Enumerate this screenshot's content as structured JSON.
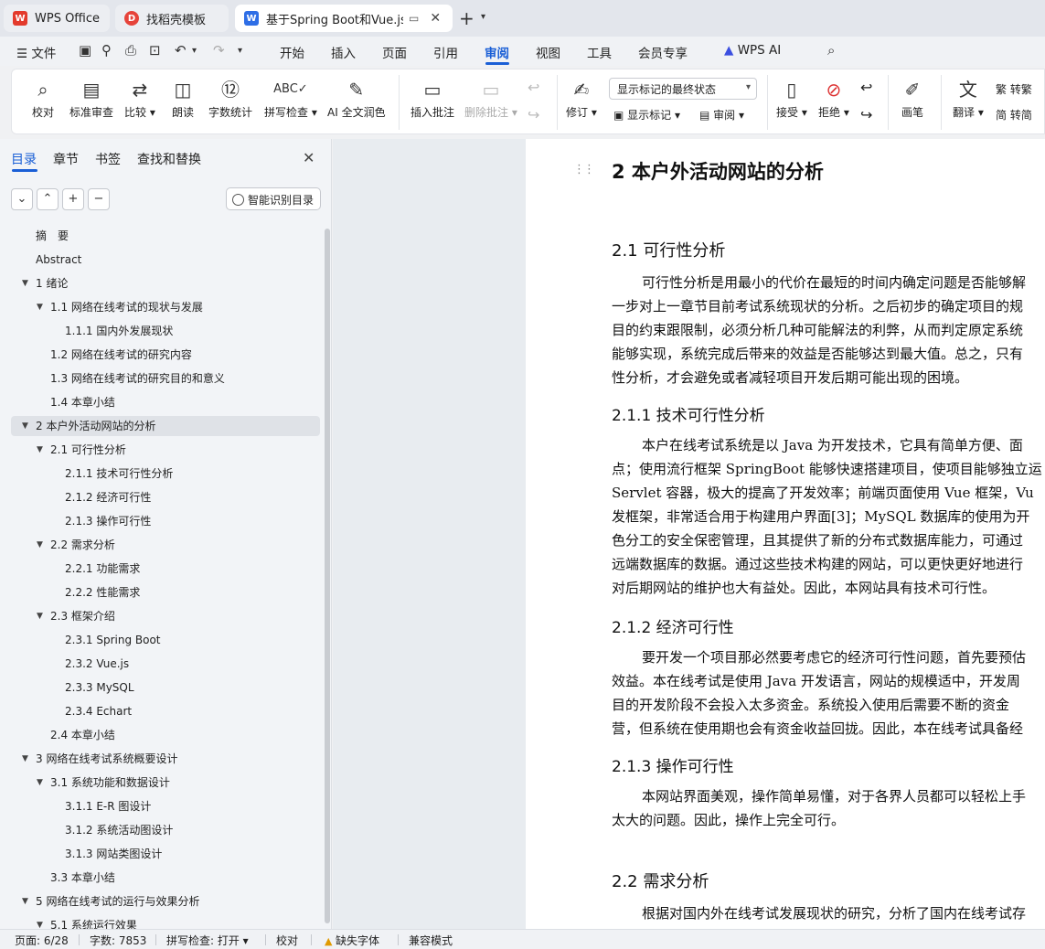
{
  "tabs": [
    {
      "label": "WPS Office",
      "icon": "wps-logo-icon"
    },
    {
      "label": "找稻壳模板",
      "icon": "docer-logo-icon"
    },
    {
      "label": "基于Spring Boot和Vue.js的户",
      "icon": "writer-doc-icon"
    }
  ],
  "menu": {
    "file": "文件",
    "items": [
      "开始",
      "插入",
      "页面",
      "引用",
      "审阅",
      "视图",
      "工具",
      "会员专享"
    ],
    "active": "审阅",
    "wps_ai": "WPS AI"
  },
  "ribbon": {
    "proofread": "校对",
    "std_review": "标准审查",
    "compare": "比较",
    "read_aloud": "朗读",
    "word_count": "字数统计",
    "spell_check": "拼写检查",
    "ai_polish": "AI 全文润色",
    "insert_comment": "插入批注",
    "delete_comment": "删除批注",
    "revise": "修订",
    "display_state": "显示标记的最终状态",
    "show_markup": "显示标记",
    "review": "审阅",
    "accept": "接受",
    "reject": "拒绝",
    "pen": "画笔",
    "translate": "翻译",
    "to_traditional": "转繁",
    "to_simplified": "转简"
  },
  "nav": {
    "tabs": [
      "目录",
      "章节",
      "书签",
      "查找和替换"
    ],
    "active_tab": "目录",
    "smart_toc": "智能识别目录",
    "toc": [
      {
        "label": "摘　要",
        "level": 0,
        "caret": false
      },
      {
        "label": "Abstract",
        "level": 0,
        "caret": false
      },
      {
        "label": "1  绪论",
        "level": 0,
        "caret": true
      },
      {
        "label": "1.1  网络在线考试的现状与发展",
        "level": 1,
        "caret": true
      },
      {
        "label": "1.1.1  国内外发展现状",
        "level": 2,
        "caret": false
      },
      {
        "label": "1.2 网络在线考试的研究内容",
        "level": 1,
        "caret": false
      },
      {
        "label": "1.3  网络在线考试的研究目的和意义",
        "level": 1,
        "caret": false
      },
      {
        "label": "1.4  本章小结",
        "level": 1,
        "caret": false
      },
      {
        "label": "2  本户外活动网站的分析",
        "level": 0,
        "caret": true,
        "selected": true
      },
      {
        "label": "2.1  可行性分析",
        "level": 1,
        "caret": true
      },
      {
        "label": "2.1.1  技术可行性分析",
        "level": 2,
        "caret": false
      },
      {
        "label": "2.1.2  经济可行性",
        "level": 2,
        "caret": false
      },
      {
        "label": "2.1.3  操作可行性",
        "level": 2,
        "caret": false
      },
      {
        "label": "2.2  需求分析",
        "level": 1,
        "caret": true
      },
      {
        "label": "2.2.1  功能需求",
        "level": 2,
        "caret": false
      },
      {
        "label": "2.2.2  性能需求",
        "level": 2,
        "caret": false
      },
      {
        "label": "2.3  框架介绍",
        "level": 1,
        "caret": true
      },
      {
        "label": "2.3.1 Spring Boot",
        "level": 2,
        "caret": false
      },
      {
        "label": "2.3.2 Vue.js",
        "level": 2,
        "caret": false
      },
      {
        "label": "2.3.3 MySQL",
        "level": 2,
        "caret": false
      },
      {
        "label": "2.3.4 Echart",
        "level": 2,
        "caret": false
      },
      {
        "label": "2.4  本章小结",
        "level": 1,
        "caret": false
      },
      {
        "label": "3  网络在线考试系统概要设计",
        "level": 0,
        "caret": true
      },
      {
        "label": "3.1  系统功能和数据设计",
        "level": 1,
        "caret": true
      },
      {
        "label": "3.1.1 E-R 图设计",
        "level": 2,
        "caret": false
      },
      {
        "label": "3.1.2  系统活动图设计",
        "level": 2,
        "caret": false
      },
      {
        "label": "3.1.3  网站类图设计",
        "level": 2,
        "caret": false
      },
      {
        "label": "3.3  本章小结",
        "level": 1,
        "caret": false
      },
      {
        "label": "5  网络在线考试的运行与效果分析",
        "level": 0,
        "caret": true
      },
      {
        "label": "5.1  系统运行效果",
        "level": 1,
        "caret": true
      }
    ]
  },
  "document": {
    "h1": "2  本户外活动网站的分析",
    "h2_1": "2.1  可行性分析",
    "p1": [
      "可行性分析是用最小的代价在最短的时间内确定问题是否能够解",
      "一步对上一章节目前考试系统现状的分析。之后初步的确定项目的规",
      "目的约束跟限制，必须分析几种可能解法的利弊，从而判定原定系统",
      "能够实现，系统完成后带来的效益是否能够达到最大值。总之，只有",
      "性分析，才会避免或者减轻项目开发后期可能出现的困境。"
    ],
    "h3_1": "2.1.1  技术可行性分析",
    "p2": [
      "本户在线考试系统是以 Java 为开发技术，它具有简单方便、面",
      "点；使用流行框架 SpringBoot 能够快速搭建项目，使项目能够独立运",
      "Servlet 容器，极大的提高了开发效率；前端页面使用 Vue 框架，Vu",
      "发框架，非常适合用于构建用户界面[3]；MySQL 数据库的使用为开",
      "色分工的安全保密管理，且其提供了新的分布式数据库能力，可通过",
      "远端数据库的数据。通过这些技术构建的网站，可以更快更好地进行",
      "对后期网站的维护也大有益处。因此，本网站具有技术可行性。"
    ],
    "h3_2": "2.1.2  经济可行性",
    "p3": [
      "要开发一个项目那必然要考虑它的经济可行性问题，首先要预估",
      "效益。本在线考试是使用 Java 开发语言，网站的规模适中，开发周",
      "目的开发阶段不会投入太多资金。系统投入使用后需要不断的资金",
      "营，但系统在使用期也会有资金收益回拢。因此，本在线考试具备经"
    ],
    "h3_3": "2.1.3  操作可行性",
    "p4": [
      "本网站界面美观，操作简单易懂，对于各界人员都可以轻松上手",
      "太大的问题。因此，操作上完全可行。"
    ],
    "h2_2": "2.2  需求分析",
    "p5": [
      "根据对国内外在线考试发展现状的研究，分析了国内在线考试存"
    ]
  },
  "status": {
    "page": "页面: 6/28",
    "words": "字数: 7853",
    "spell": "拼写检查: 打开",
    "proof": "校对",
    "missing_font": "缺失字体",
    "compat": "兼容模式"
  }
}
